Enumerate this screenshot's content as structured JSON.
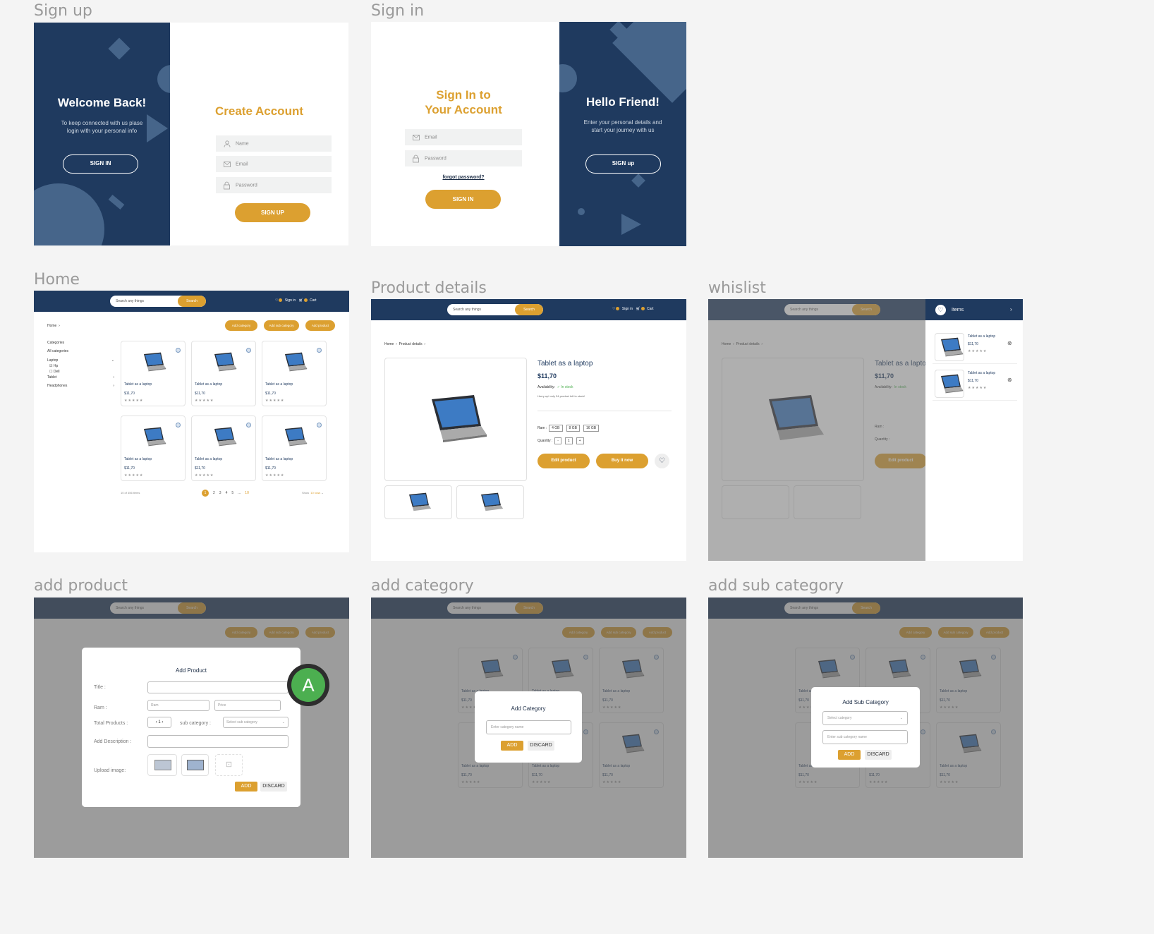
{
  "frames": {
    "signup": "Sign up",
    "signin": "Sign in",
    "home": "Home",
    "product_details": "Product details",
    "whislist": "whislist",
    "add_product": "add product",
    "add_category": "add category",
    "add_sub_category": "add sub category"
  },
  "signup": {
    "welcome_title": "Welcome Back!",
    "welcome_text_1": "To keep connected with us plase",
    "welcome_text_2": "login with your personal info",
    "signin_button": "SIGN IN",
    "create_title": "Create Account",
    "name_placeholder": "Name",
    "email_placeholder": "Email",
    "password_placeholder": "Password",
    "signup_button": "SIGN UP"
  },
  "signin": {
    "title_1": "Sign In to",
    "title_2": "Your Account",
    "email_placeholder": "Email",
    "password_placeholder": "Password",
    "forgot": "forgot password?",
    "signin_button": "SIGN IN",
    "hello_title": "Hello Friend!",
    "hello_text_1": "Enter your personal details and",
    "hello_text_2": "start your journey with us",
    "signup_button": "SIGN up"
  },
  "header": {
    "search_placeholder": "Search any things",
    "search_button": "Search",
    "signin": "Sign in",
    "cart": "Cart"
  },
  "home": {
    "crumb": "Home",
    "add_category": "Add category",
    "add_sub_category": "Add sub category",
    "add_product": "Add product",
    "categories_title": "Categories",
    "all_categories": "All categories",
    "laptop": "Laptop",
    "hp": "Hp",
    "dell": "Dell",
    "tablet": "Tablet",
    "headphones": "Headphones",
    "card_title": "Tablet as a laptop",
    "card_price": "$11,70",
    "stars": "★★★★★",
    "items_count": "10 of 456 items",
    "pages": [
      "1",
      "2",
      "3",
      "4",
      "5",
      "...",
      "10"
    ],
    "show_label": "Show",
    "show_value": "10 rows"
  },
  "product": {
    "crumb_home": "Home",
    "crumb_details": "Product details",
    "title": "Tablet as a laptop",
    "price": "$11,70",
    "availability_label": "Availability:",
    "availability_value": "In stock",
    "hurry": "Hurry up! only 34 product left in stock!",
    "ram_label": "Ram :",
    "ram_options": [
      "4 GB",
      "8 GB",
      "16 GB"
    ],
    "quantity_label": "Quantity :",
    "quantity_minus": "-",
    "quantity_value": "1",
    "quantity_plus": "+",
    "edit_button": "Edit product",
    "buy_button": "Buy it now"
  },
  "wishlist": {
    "title": "Items",
    "item_title": "Tablet as a laptop",
    "item_price": "$11,70"
  },
  "add_product_modal": {
    "title": "Add Product",
    "title_label": "Title :",
    "ram_label": "Ram :",
    "ram_placeholder": "Ram",
    "price_placeholder": "Price",
    "total_label": "Total Products :",
    "total_value": "1",
    "sub_category_label": "sub category :",
    "sub_category_placeholder": "Select sub category",
    "description_label": "Add Description :",
    "upload_label": "Upload image:",
    "add_button": "ADD",
    "discard_button": "DISCARD",
    "avatar_letter": "A"
  },
  "add_category_modal": {
    "title": "Add Category",
    "placeholder": "Enter category name",
    "add_button": "ADD",
    "discard_button": "DISCARD"
  },
  "add_sub_category_modal": {
    "title": "Add Sub Category",
    "select_placeholder": "Select category",
    "name_placeholder": "Enter sub category name",
    "add_button": "ADD",
    "discard_button": "DISCARD"
  },
  "colors": {
    "navy": "#1f3a5f",
    "gold": "#dca030",
    "green": "#4caf50"
  }
}
